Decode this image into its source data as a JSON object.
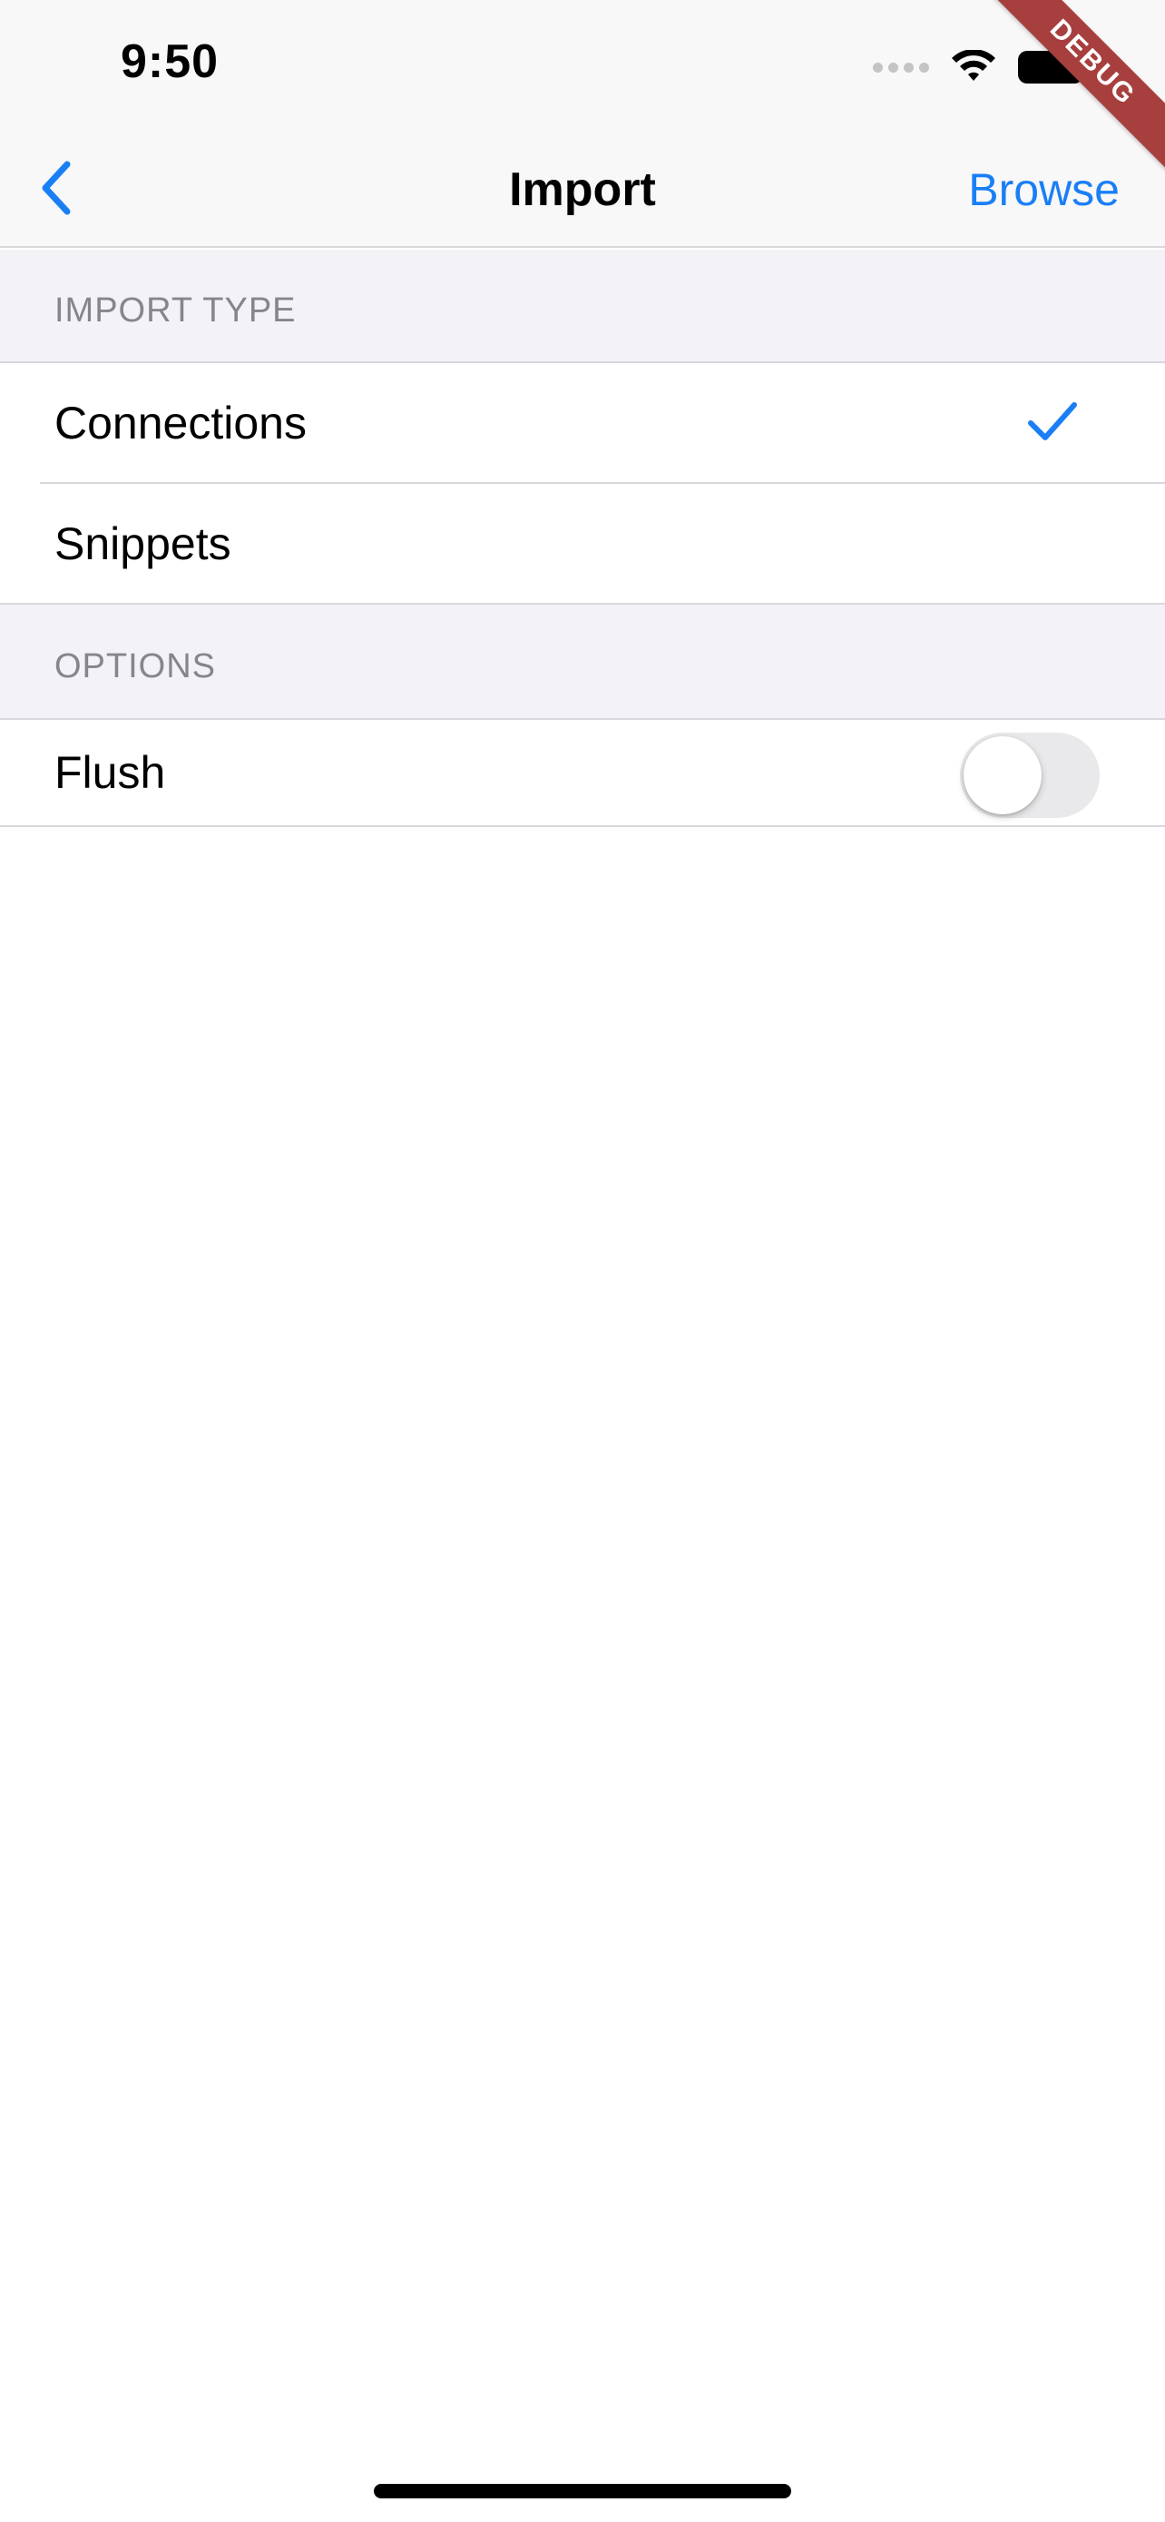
{
  "status_bar": {
    "time": "9:50",
    "icons": [
      "cellular-signal-icon",
      "wifi-icon",
      "battery-icon"
    ]
  },
  "debug_banner": "DEBUG",
  "nav": {
    "back_icon": "chevron-left-icon",
    "title": "Import",
    "action": "Browse"
  },
  "sections": {
    "import_type": {
      "header": "IMPORT TYPE",
      "items": [
        {
          "label": "Connections",
          "selected": true
        },
        {
          "label": "Snippets",
          "selected": false
        }
      ]
    },
    "options": {
      "header": "OPTIONS",
      "items": [
        {
          "label": "Flush",
          "toggle": false
        }
      ]
    }
  },
  "colors": {
    "accent": "#1a7ff5",
    "debug_ribbon": "#a83f3f",
    "grouped_background": "#f2f2f7"
  }
}
